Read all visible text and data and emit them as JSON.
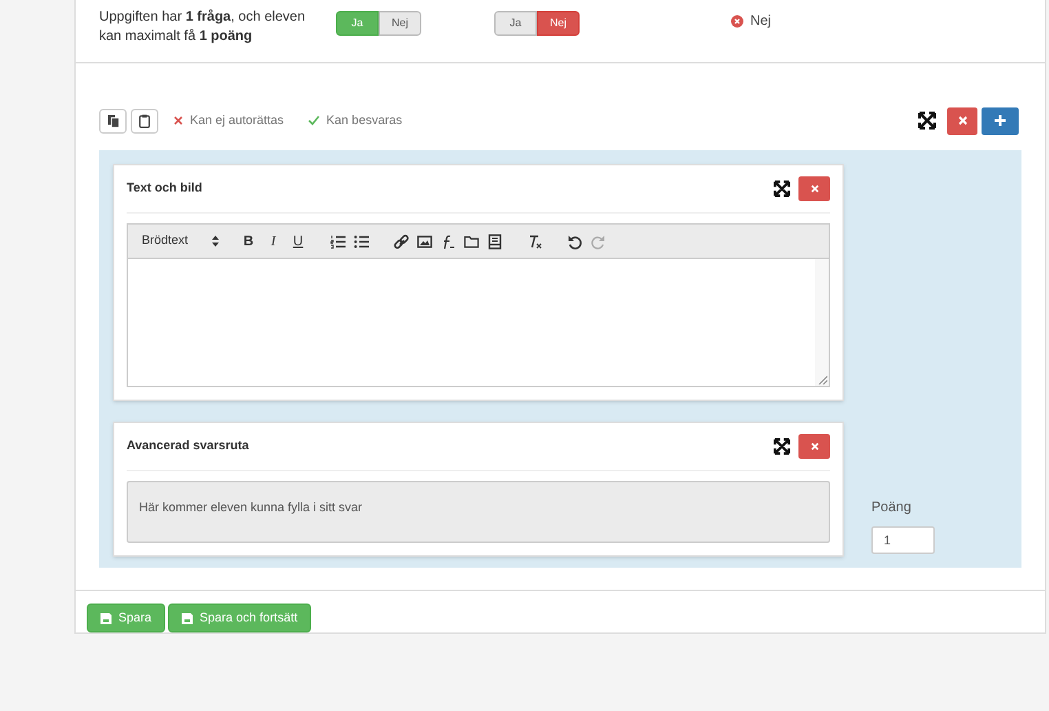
{
  "status": {
    "text": "Uppgiften har **1 fråga**, och eleven kan maximalt få **1 poäng**"
  },
  "toggles": [
    {
      "options": [
        {
          "label": "Ja",
          "kind": "yes",
          "selected": true
        },
        {
          "label": "Nej",
          "kind": "no",
          "selected": false
        }
      ]
    },
    {
      "options": [
        {
          "label": "Ja",
          "kind": "yes",
          "selected": false
        },
        {
          "label": "Nej",
          "kind": "no",
          "selected": true
        }
      ]
    }
  ],
  "autocorrect": {
    "value": "Nej",
    "kind": "no"
  },
  "flags": [
    {
      "label": "Kan ej autorättas",
      "kind": "no"
    },
    {
      "label": "Kan besvaras",
      "kind": "yes"
    }
  ],
  "blocks": [
    {
      "kind": "text",
      "title": "Text och bild",
      "editor": {
        "format": "Brödtext",
        "formatting": [
          "B",
          "I",
          "U"
        ],
        "redo_disabled": true
      }
    },
    {
      "kind": "answer",
      "title": "Avancerad svarsruta",
      "placeholder": "Här kommer eleven kunna fylla i sitt svar"
    }
  ],
  "points": {
    "label": "Poäng",
    "value": "1"
  },
  "buttons": [
    {
      "label": "Spara"
    },
    {
      "label": "Spara och fortsätt"
    }
  ]
}
